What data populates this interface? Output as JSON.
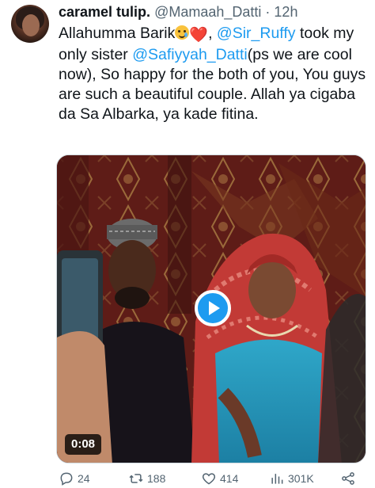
{
  "tweet": {
    "author_name": "caramel tulip.",
    "handle": "@Mamaah_Datti",
    "separator": "·",
    "time": "12h",
    "text_line1": "Allahumma Barik",
    "text_comma": ", ",
    "mention1": "@Sir_Ruffy",
    "text_after_mention1": " took my only sister ",
    "mention2": "@Safiyyah_Datti",
    "text_after_mention2": "(ps we are cool now), So happy for the both of you, You guys are such a beautiful couple. Allah ya cigaba da Sa Albarka, ya kade fitina.",
    "emoji_heart": "❤️"
  },
  "media": {
    "duration": "0:08"
  },
  "actions": {
    "replies": "24",
    "retweets": "188",
    "likes": "414",
    "views": "301K"
  },
  "colors": {
    "accent": "#1d9bf0",
    "muted": "#536471",
    "text": "#0f1419"
  }
}
